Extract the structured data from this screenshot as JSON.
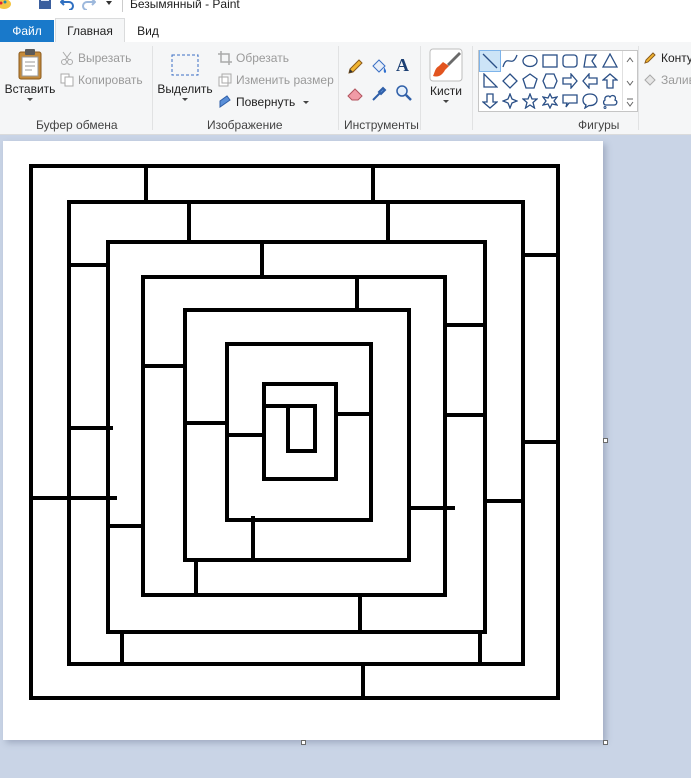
{
  "window": {
    "title": "Безымянный - Paint"
  },
  "tabs": {
    "file": "Файл",
    "home": "Главная",
    "view": "Вид"
  },
  "clipboard": {
    "paste": "Вставить",
    "cut": "Вырезать",
    "copy": "Копировать",
    "group": "Буфер обмена"
  },
  "image": {
    "select": "Выделить",
    "crop": "Обрезать",
    "resize": "Изменить размер",
    "rotate": "Повернуть",
    "group": "Изображение"
  },
  "tools": {
    "group": "Инструменты",
    "pencil_icon": "pencil-icon",
    "fill_icon": "fill-bucket-icon",
    "text_glyph": "A",
    "eraser_icon": "eraser-icon",
    "picker_icon": "color-picker-icon",
    "magnifier_icon": "magnifier-icon"
  },
  "brushes": {
    "label": "Кисти"
  },
  "shapes": {
    "group": "Фигуры",
    "outline": "Конту",
    "fill": "Залив",
    "selected": "line"
  },
  "colors": {
    "accent": "#1979ca",
    "workspace": "#c9d4e6",
    "ribbon": "#f5f6f7",
    "selection": "#cce4f7",
    "ink": "#000000"
  }
}
